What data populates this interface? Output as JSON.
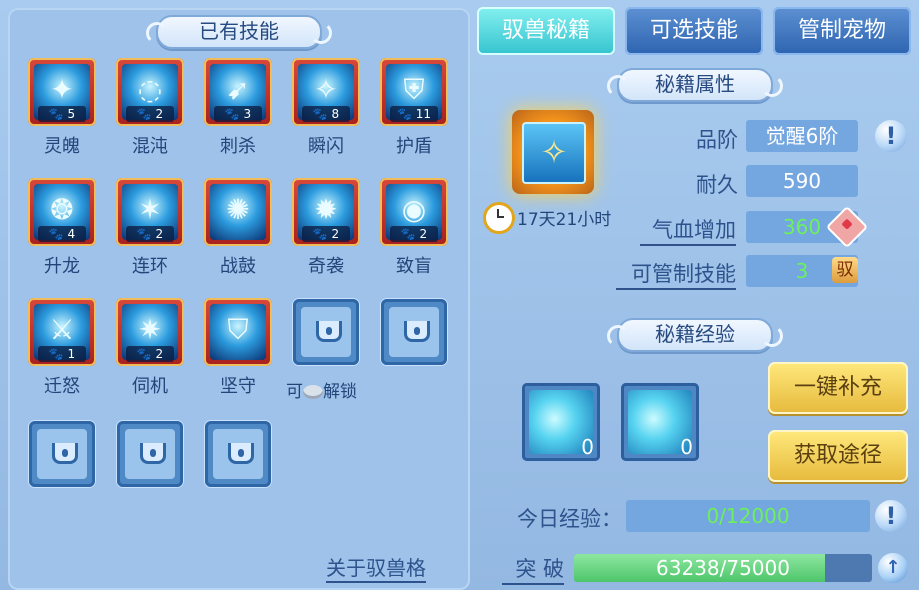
{
  "left_header": "已有技能",
  "skills": [
    {
      "name": "灵魄",
      "count": "5",
      "sym": "✦"
    },
    {
      "name": "混沌",
      "count": "2",
      "sym": "◌"
    },
    {
      "name": "刺杀",
      "count": "3",
      "sym": "➹"
    },
    {
      "name": "瞬闪",
      "count": "8",
      "sym": "✧"
    },
    {
      "name": "护盾",
      "count": "11",
      "sym": "⛨"
    },
    {
      "name": "升龙",
      "count": "4",
      "sym": "❂"
    },
    {
      "name": "连环",
      "count": "2",
      "sym": "✶"
    },
    {
      "name": "战鼓",
      "count": "",
      "sym": "✺"
    },
    {
      "name": "奇袭",
      "count": "2",
      "sym": "✹"
    },
    {
      "name": "致盲",
      "count": "2",
      "sym": "◉"
    },
    {
      "name": "迁怒",
      "count": "1",
      "sym": "⚔"
    },
    {
      "name": "伺机",
      "count": "2",
      "sym": "✷"
    },
    {
      "name": "坚守",
      "count": "",
      "sym": "⛉"
    }
  ],
  "unlock_text_a": "可",
  "unlock_text_b": "解锁",
  "about_link": "关于驭兽格",
  "tabs": [
    "驭兽秘籍",
    "可选技能",
    "管制宠物"
  ],
  "attr_header": "秘籍属性",
  "exp_header": "秘籍经验",
  "timer": "17天21小时",
  "attrs": {
    "grade_label": "品阶",
    "grade_value": "觉醒6阶",
    "durability_label": "耐久",
    "durability_value": "590",
    "hp_label": "气血增加",
    "hp_value": "360",
    "control_label": "可管制技能",
    "control_value": "3",
    "control_icon": "驭"
  },
  "horses": [
    {
      "count": "0"
    },
    {
      "count": "0"
    }
  ],
  "buttons": {
    "refill": "一键补充",
    "obtain": "获取途径"
  },
  "today_exp_label": "今日经验：",
  "today_exp_value": "0/12000",
  "breakthrough_label": "突 破",
  "breakthrough_value": "63238/75000",
  "breakthrough_progress": 0.843
}
